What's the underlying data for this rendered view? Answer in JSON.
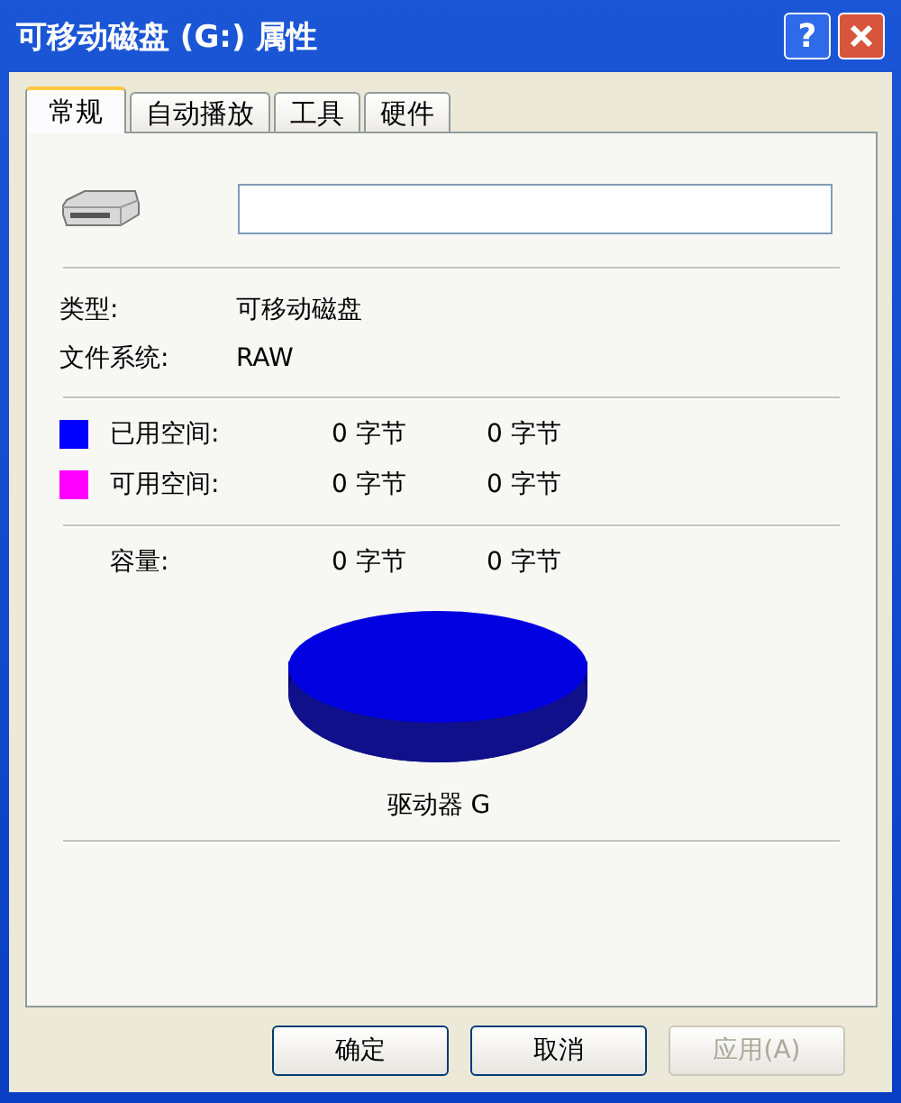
{
  "window": {
    "title": "可移动磁盘 (G:) 属性",
    "help_label": "?"
  },
  "tabs": [
    {
      "label": "常规",
      "selected": true
    },
    {
      "label": "自动播放",
      "selected": false
    },
    {
      "label": "工具",
      "selected": false
    },
    {
      "label": "硬件",
      "selected": false
    }
  ],
  "info": [
    {
      "label": "类型:",
      "value": "可移动磁盘"
    },
    {
      "label": "文件系统:",
      "value": "RAW"
    }
  ],
  "space": [
    {
      "label": "已用空间:",
      "color": "#0000ff",
      "bytes": "0 字节",
      "size": "0 字节"
    },
    {
      "label": "可用空间:",
      "color": "#ff00ff",
      "bytes": "0 字节",
      "size": "0 字节"
    }
  ],
  "capacity": {
    "label": "容量:",
    "bytes": "0 字节",
    "size": "0 字节"
  },
  "drive_label": "驱动器 G",
  "buttons": [
    {
      "label": "确定",
      "disabled": false
    },
    {
      "label": "取消",
      "disabled": false
    },
    {
      "label": "应用(A)",
      "disabled": true
    }
  ]
}
